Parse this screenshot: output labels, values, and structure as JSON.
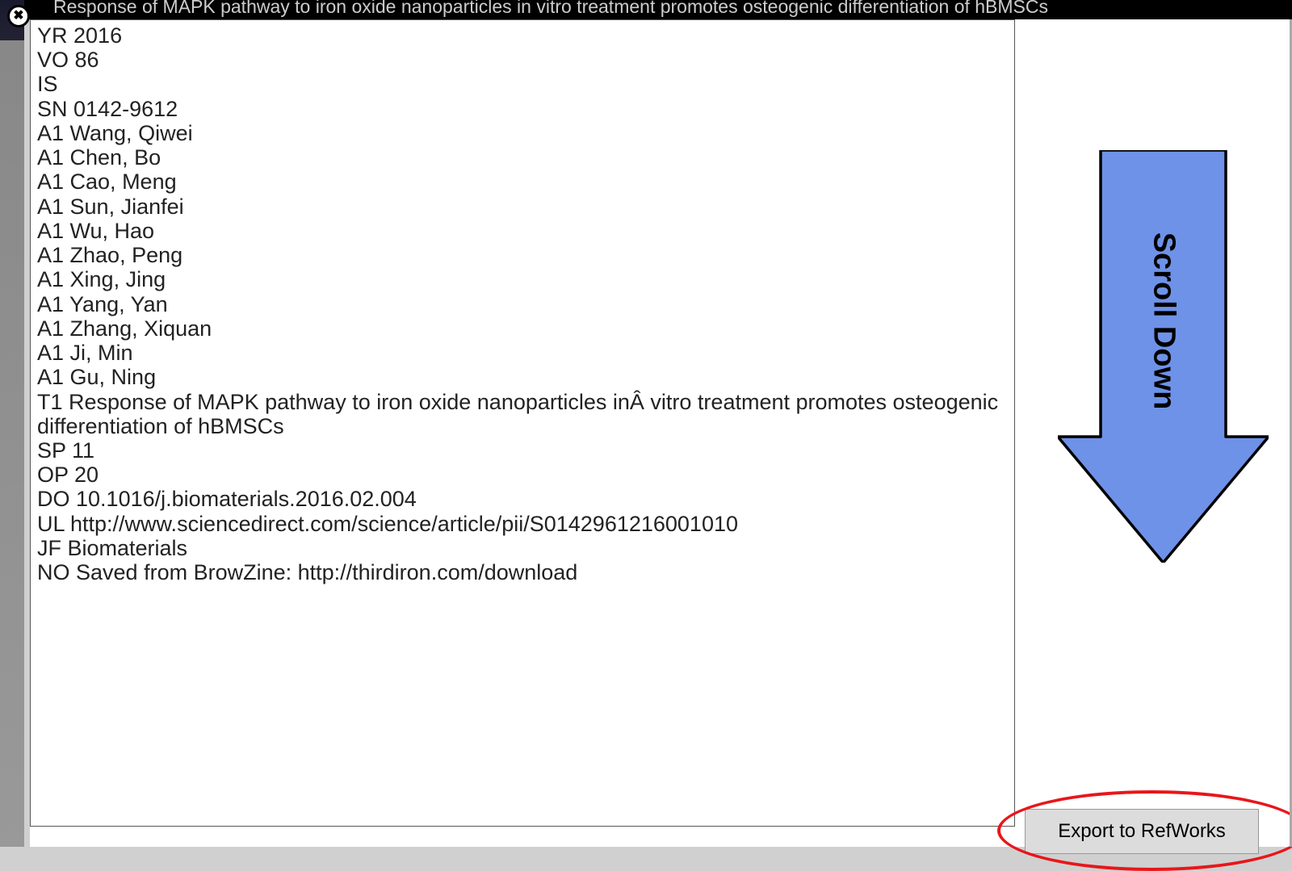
{
  "titleBar": "Response of MAPK pathway to iron oxide nanoparticles in vitro treatment promotes osteogenic differentiation of hBMSCs",
  "citation": {
    "YR": "2016",
    "VO": "86",
    "IS": "",
    "SN": "0142-9612",
    "authors": [
      "Wang, Qiwei",
      "Chen, Bo",
      "Cao, Meng",
      "Sun, Jianfei",
      "Wu, Hao",
      "Zhao, Peng",
      "Xing, Jing",
      "Yang, Yan",
      "Zhang, Xiquan",
      "Ji, Min",
      "Gu, Ning"
    ],
    "T1": "Response of MAPK pathway to iron oxide nanoparticles inÂ vitro treatment promotes osteogenic differentiation of hBMSCs",
    "SP": "11",
    "OP": "20",
    "DO": "10.1016/j.biomaterials.2016.02.004",
    "UL": "http://www.sciencedirect.com/science/article/pii/S0142961216001010",
    "JF": "Biomaterials",
    "NO": "Saved from BrowZine: http://thirdiron.com/download"
  },
  "arrowLabel": "Scroll Down",
  "exportLabel": "Export to RefWorks",
  "colors": {
    "arrowFill": "#6e92e8",
    "arrowStroke": "#000000",
    "circleStroke": "#e8161a"
  }
}
